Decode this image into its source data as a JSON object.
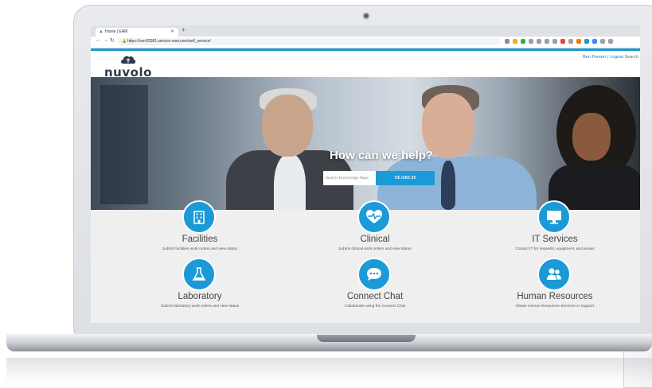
{
  "browser": {
    "tab_title": "Home | EAM",
    "new_tab": "+",
    "url": "https://ven02081.service-now.com/self_service/"
  },
  "site": {
    "logo_text": "nuvolo",
    "user_name": "Ben Persen",
    "logout": "Logout",
    "search_link": "Search"
  },
  "hero": {
    "title": "How can we help?",
    "search_placeholder": "Search Knowledge Base",
    "search_button": "SEARCH"
  },
  "services": [
    {
      "name": "Facilities",
      "desc": "Submit facilities work orders and view status",
      "icon": "building-icon"
    },
    {
      "name": "Clinical",
      "desc": "Submit clinical work orders and view status",
      "icon": "heart-pulse-icon"
    },
    {
      "name": "IT Services",
      "desc": "Contact IT for requests, equipment, and issues",
      "icon": "monitor-icon"
    },
    {
      "name": "Laboratory",
      "desc": "Submit laboratory work orders and view status",
      "icon": "flask-icon"
    },
    {
      "name": "Connect Chat",
      "desc": "Collaborate using the Connect Chat",
      "icon": "chat-bubble-icon"
    },
    {
      "name": "Human Resources",
      "desc": "Obtain Human Resources Services or Support",
      "icon": "users-icon"
    }
  ],
  "colors": {
    "accent": "#1b9ad7",
    "logo": "#2d3a4a",
    "services_bg": "#efefef"
  }
}
